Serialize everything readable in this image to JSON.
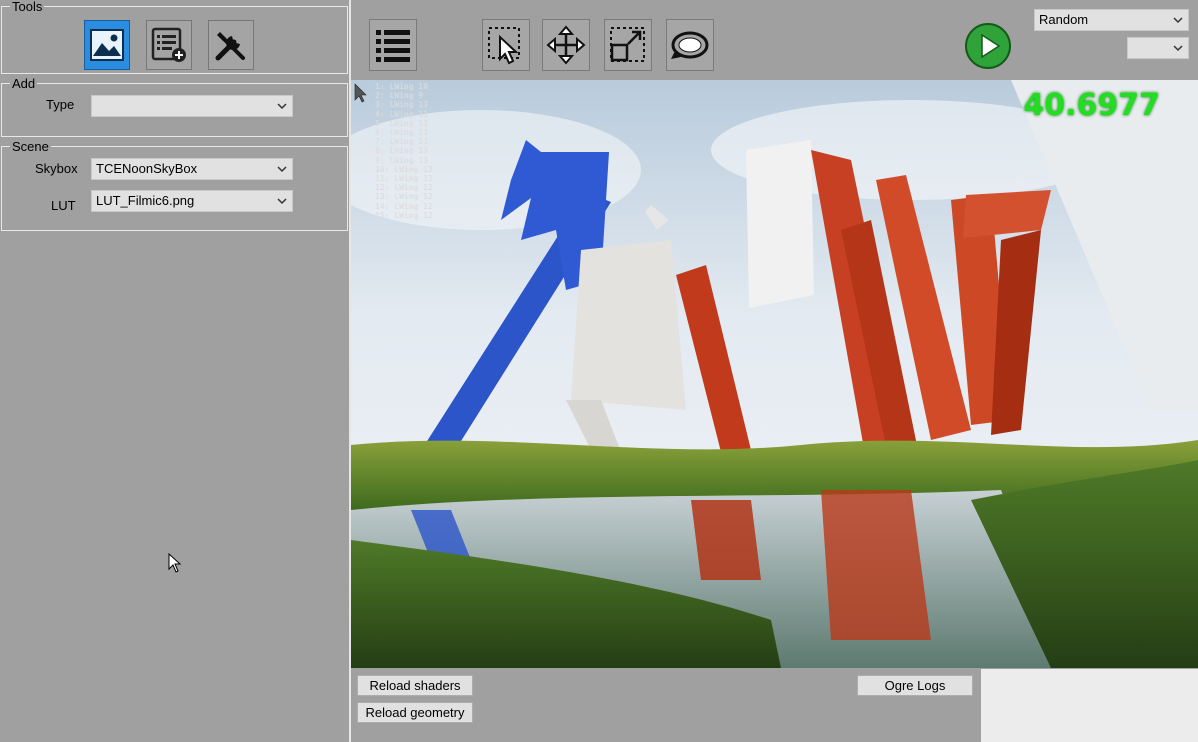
{
  "tools": {
    "legend": "Tools",
    "buttons": [
      {
        "icon": "image-icon",
        "active": true
      },
      {
        "icon": "list-add-icon",
        "active": false
      },
      {
        "icon": "tools-icon",
        "active": false
      }
    ]
  },
  "add": {
    "legend": "Add",
    "type_label": "Type",
    "type_value": ""
  },
  "scene": {
    "legend": "Scene",
    "skybox_label": "Skybox",
    "skybox_value": "TCENoonSkyBox",
    "lut_label": "LUT",
    "lut_value": "LUT_Filmic6.png"
  },
  "toolbar": {
    "icons": [
      "list-icon",
      "select-arrow-icon",
      "move-icon",
      "scale-icon",
      "rotate-icon",
      "play-icon"
    ],
    "mode_select": "Random",
    "secondary_select": ""
  },
  "viewport": {
    "fps": "40.6977",
    "stats": [
      "1: LWing 10",
      "2: LWing 9",
      "3: LWing 13",
      "4: LWing 13",
      "5: LWing 13",
      "6: LWing 13",
      "7: LWing 13",
      "8: LWing 13",
      "9: LWing 13",
      "10: LWing 13",
      "11: LWing 12",
      "12: LWing 12",
      "13: LWing 12",
      "14: LWing 12",
      "15: LWing 12"
    ]
  },
  "bottom": {
    "reload_shaders": "Reload shaders",
    "reload_geometry": "Reload geometry",
    "ogre_logs": "Ogre Logs"
  },
  "colors": {
    "accent": "#2b8de0",
    "fps": "#22dd22",
    "play": "#2fa33a"
  }
}
